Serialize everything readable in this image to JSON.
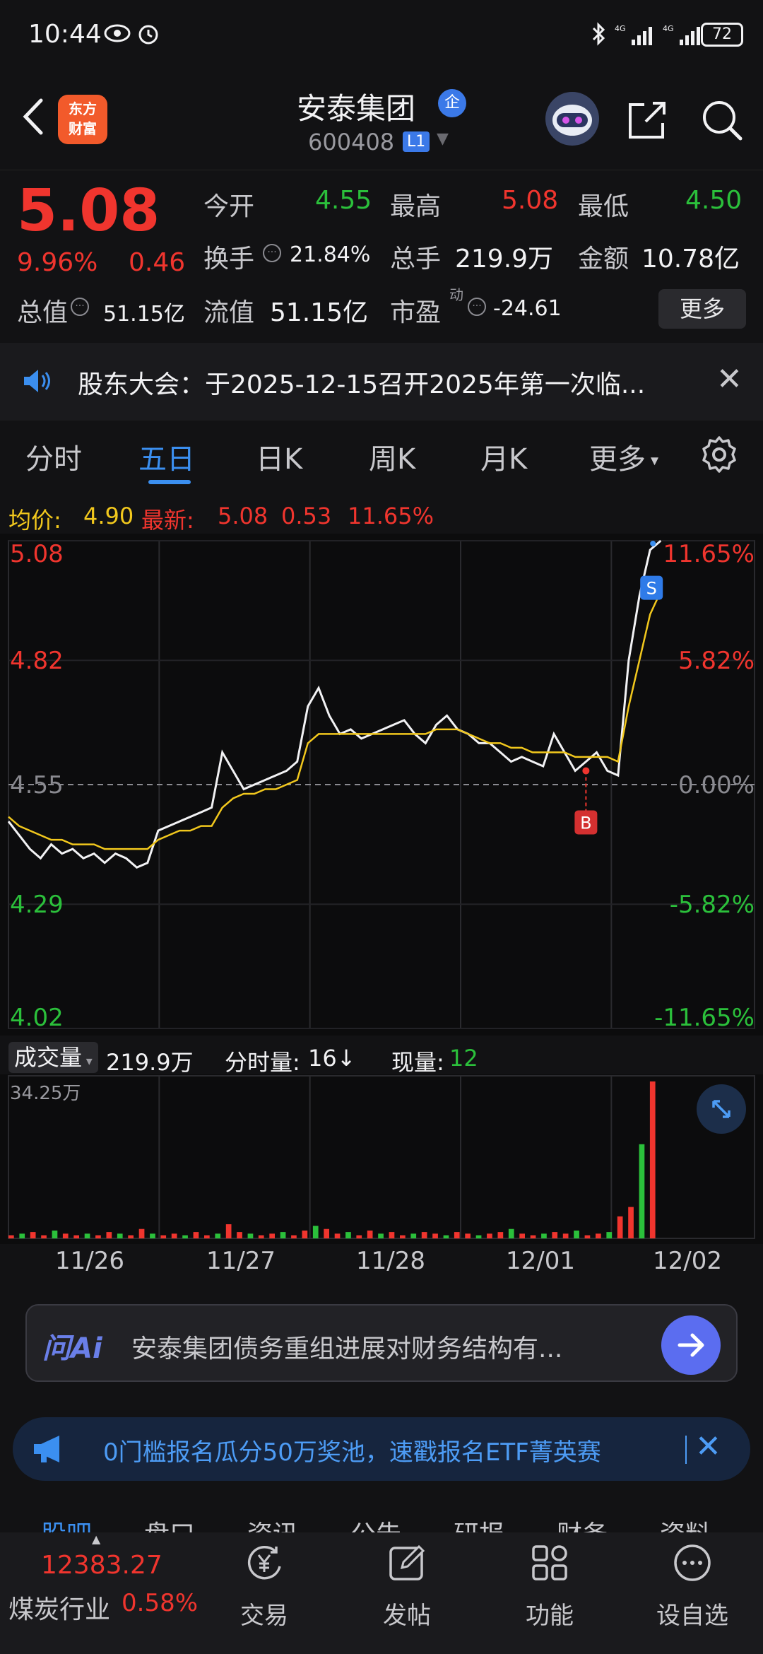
{
  "status_bar": {
    "time": "10:44",
    "network": "4G",
    "battery": "72"
  },
  "header": {
    "logo_text": "东方财富",
    "stock_name": "安泰集团",
    "badge": "企",
    "stock_code": "600408",
    "level": "L1"
  },
  "quote": {
    "price": "5.08",
    "change_pct": "9.96%",
    "change": "0.46",
    "open_label": "今开",
    "open": "4.55",
    "high_label": "最高",
    "high": "5.08",
    "low_label": "最低",
    "low": "4.50",
    "turnover_label": "换手",
    "turnover": "21.84%",
    "volume_label": "总手",
    "volume": "219.9万",
    "amount_label": "金额",
    "amount": "10.78亿",
    "mktcap_label": "总值",
    "mktcap": "51.15亿",
    "float_label": "流值",
    "float": "51.15亿",
    "pe_label": "市盈",
    "pe_sup": "动",
    "pe": "-24.61",
    "more": "更多"
  },
  "notice": {
    "text": "股东大会：于2025-12-15召开2025年第一次临..."
  },
  "tabs": [
    "分时",
    "五日",
    "日K",
    "周K",
    "月K",
    "更多"
  ],
  "chart_info": {
    "avg_label": "均价:",
    "avg": "4.90",
    "latest_label": "最新:",
    "latest": "5.08",
    "chg": "0.53",
    "chg_pct": "11.65%"
  },
  "chart_data": {
    "type": "line",
    "title": "",
    "x": [
      "11/26",
      "11/27",
      "11/28",
      "12/01",
      "12/02"
    ],
    "ylim": [
      4.02,
      5.08
    ],
    "y_ticks_left": [
      "5.08",
      "4.82",
      "4.55",
      "4.29",
      "4.02"
    ],
    "y_ticks_right": [
      "11.65%",
      "5.82%",
      "0.00%",
      "-5.82%",
      "-11.65%"
    ],
    "series": [
      {
        "name": "价格",
        "values": [
          4.47,
          4.44,
          4.41,
          4.39,
          4.42,
          4.4,
          4.41,
          4.39,
          4.4,
          4.38,
          4.4,
          4.39,
          4.37,
          4.38,
          4.45,
          4.46,
          4.47,
          4.48,
          4.49,
          4.5,
          4.62,
          4.58,
          4.54,
          4.55,
          4.56,
          4.57,
          4.58,
          4.6,
          4.72,
          4.76,
          4.7,
          4.66,
          4.67,
          4.65,
          4.66,
          4.67,
          4.68,
          4.69,
          4.66,
          4.64,
          4.68,
          4.7,
          4.67,
          4.66,
          4.64,
          4.64,
          4.62,
          4.6,
          4.61,
          4.6,
          4.59,
          4.66,
          4.62,
          4.58,
          4.6,
          4.62,
          4.58,
          4.57,
          4.82,
          4.96,
          5.06,
          5.08
        ]
      },
      {
        "name": "均价",
        "values": [
          4.48,
          4.46,
          4.45,
          4.44,
          4.43,
          4.43,
          4.42,
          4.42,
          4.42,
          4.41,
          4.41,
          4.41,
          4.41,
          4.41,
          4.43,
          4.44,
          4.45,
          4.45,
          4.46,
          4.46,
          4.5,
          4.52,
          4.53,
          4.53,
          4.54,
          4.54,
          4.55,
          4.56,
          4.64,
          4.66,
          4.66,
          4.66,
          4.66,
          4.66,
          4.66,
          4.66,
          4.66,
          4.66,
          4.66,
          4.66,
          4.67,
          4.67,
          4.67,
          4.66,
          4.65,
          4.64,
          4.64,
          4.63,
          4.63,
          4.62,
          4.62,
          4.62,
          4.62,
          4.61,
          4.61,
          4.61,
          4.61,
          4.6,
          4.72,
          4.82,
          4.92,
          4.97
        ]
      }
    ],
    "markers": [
      {
        "label": "B",
        "value": 4.58
      },
      {
        "label": "S",
        "value": 4.97
      }
    ]
  },
  "volume": {
    "label": "成交量",
    "total": "219.9万",
    "per_min_label": "分时量:",
    "per_min": "16↓",
    "now_label": "现量:",
    "now": "12",
    "max": "34.25万",
    "bars": [
      2,
      3,
      4,
      2,
      5,
      3,
      2,
      3,
      2,
      4,
      3,
      2,
      6,
      3,
      2,
      3,
      2,
      4,
      2,
      3,
      9,
      4,
      3,
      2,
      3,
      4,
      2,
      5,
      8,
      6,
      3,
      4,
      2,
      5,
      3,
      4,
      2,
      3,
      4,
      3,
      2,
      4,
      3,
      2,
      3,
      4,
      6,
      3,
      2,
      3,
      4,
      3,
      5,
      2,
      3,
      4,
      14,
      20,
      60,
      100
    ]
  },
  "ai": {
    "logo": "问Ai",
    "text": "安泰集团债务重组进展对财务结构有..."
  },
  "promo": {
    "text": "0门槛报名瓜分50万奖池，速戳报名ETF菁英赛"
  },
  "bottom_tabs": [
    "股吧",
    "盘口",
    "资讯",
    "公告",
    "研报",
    "财务",
    "资料"
  ],
  "bottom": {
    "index_value": "12383.27",
    "index_name": "煤炭行业",
    "index_pct": "0.58%",
    "nav": [
      "交易",
      "发帖",
      "功能",
      "设自选"
    ]
  }
}
